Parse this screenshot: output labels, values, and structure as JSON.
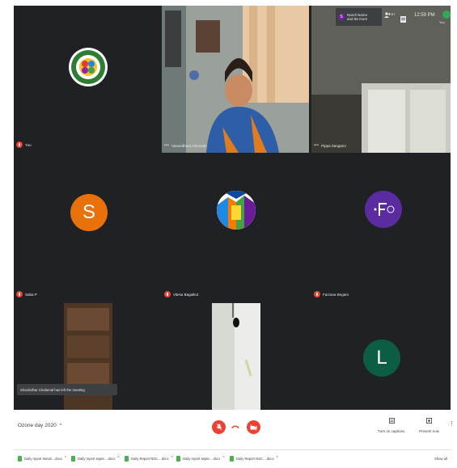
{
  "topbar": {
    "presenter_initial": "S",
    "presenter_line1": "Nandi Namu",
    "presenter_line2": "and 86 more",
    "participants_count": "87",
    "time": "12:59 PM",
    "self_label": "You"
  },
  "tiles": [
    {
      "label": "You"
    },
    {
      "label": "Vasundhara Hiremath"
    },
    {
      "label": "Pippa Sangami"
    },
    {
      "label": "Saba P",
      "initial": "S"
    },
    {
      "label": "Vitesa Bagalkot"
    },
    {
      "label": "Farzana Begam"
    },
    {
      "label": ""
    },
    {
      "label": ""
    },
    {
      "label": "",
      "initial": "L"
    }
  ],
  "toast": "Shashidhar Chalamal has left the meeting",
  "bottombar": {
    "meeting_name": "Ozone day 2020",
    "captions_label": "Turn on captions",
    "present_label": "Present now"
  },
  "downloads": {
    "items": [
      "Daily report Ismail....docx",
      "Daily report septe....docx",
      "Daily Report NSC....docx",
      "Daily report septe....docx",
      "Daily Report NSC....docx"
    ],
    "show_all": "Show all"
  },
  "colors": {
    "call_bg": "#202124",
    "avatar_orange": "#e8710a",
    "avatar_purple": "#5b2c9f",
    "avatar_green": "#0b5e45",
    "red": "#ea4335"
  }
}
